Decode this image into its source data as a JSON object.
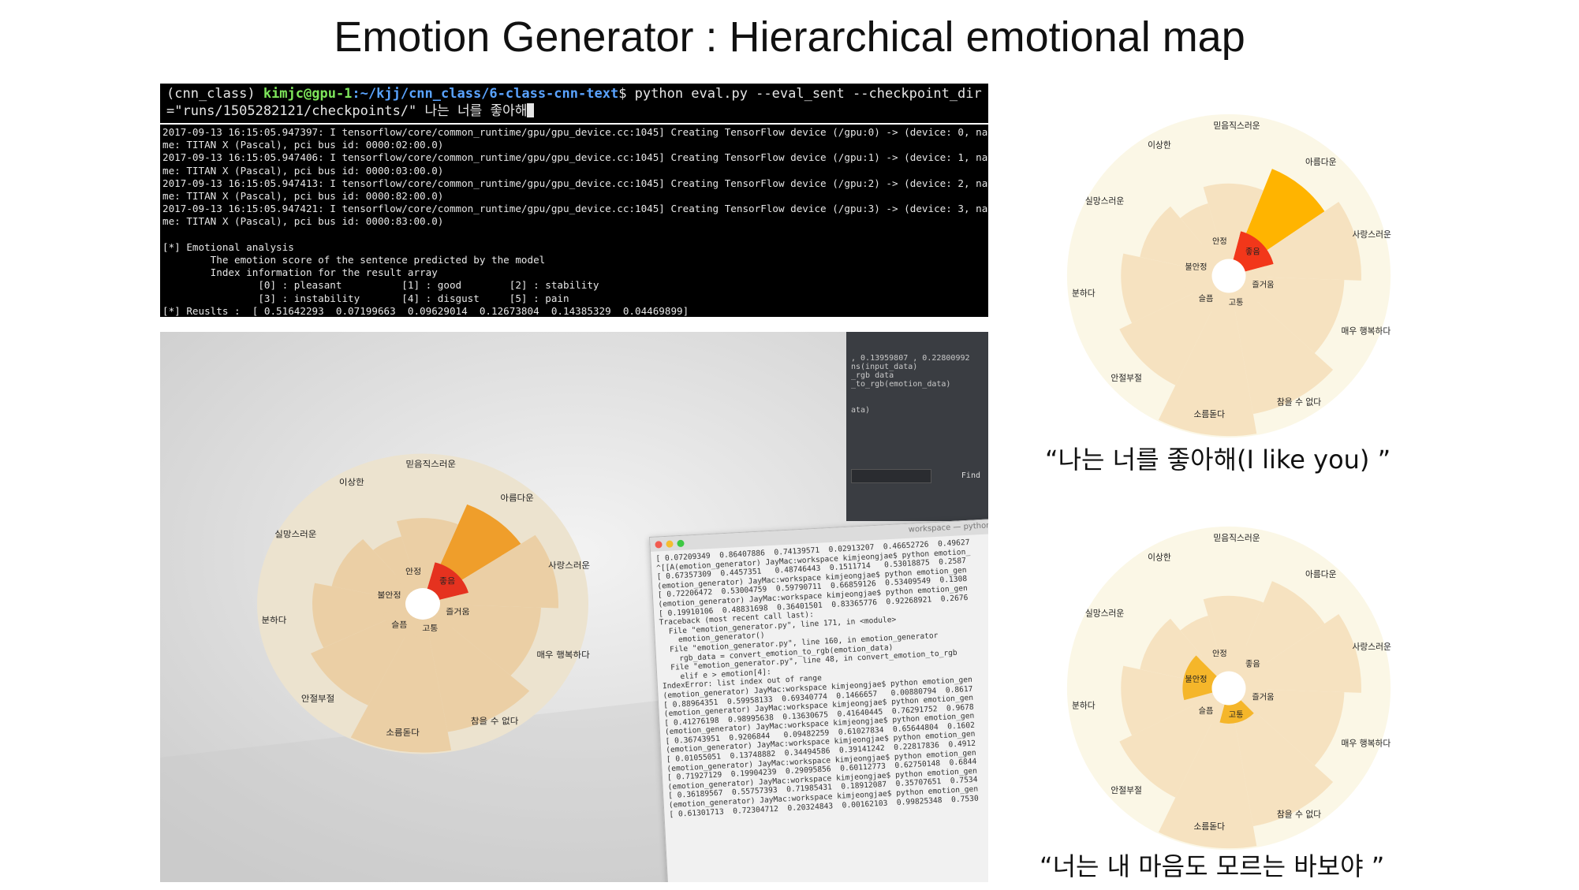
{
  "title": "Emotion Generator : Hierarchical emotional map",
  "terminal": {
    "env": "(cnn_class) ",
    "user": "kimjc@gpu-1",
    "path": ":~/kjj/cnn_class/6-class-cnn-text",
    "command": "$ python eval.py --eval_sent --checkpoint_dir",
    "command_cont": "=\"runs/1505282121/checkpoints/\" 나는 너를 좋아해",
    "log_lines": [
      "2017-09-13 16:15:05.947397: I tensorflow/core/common_runtime/gpu/gpu_device.cc:1045] Creating TensorFlow device (/gpu:0) -> (device: 0, na",
      "me: TITAN X (Pascal), pci bus id: 0000:02:00.0)",
      "2017-09-13 16:15:05.947406: I tensorflow/core/common_runtime/gpu/gpu_device.cc:1045] Creating TensorFlow device (/gpu:1) -> (device: 1, na",
      "me: TITAN X (Pascal), pci bus id: 0000:03:00.0)",
      "2017-09-13 16:15:05.947413: I tensorflow/core/common_runtime/gpu/gpu_device.cc:1045] Creating TensorFlow device (/gpu:2) -> (device: 2, na",
      "me: TITAN X (Pascal), pci bus id: 0000:82:00.0)",
      "2017-09-13 16:15:05.947421: I tensorflow/core/common_runtime/gpu/gpu_device.cc:1045] Creating TensorFlow device (/gpu:3) -> (device: 3, na",
      "me: TITAN X (Pascal), pci bus id: 0000:83:00.0)",
      "",
      "[*] Emotional analysis",
      "        The emotion score of the sentence predicted by the model",
      "        Index information for the result array",
      "                [0] : pleasant          [1] : good        [2] : stability",
      "                [3] : instability       [4] : disgust     [5] : pain",
      "[*] Reuslts :  [ 0.51642293  0.07199663  0.09629014  0.12673804  0.14385329  0.04469899]"
    ]
  },
  "photo": {
    "editor_lines": [
      ", 0.13959807 , 0.22800992",
      "ns(input_data)",
      "_rgb data",
      "_to_rgb(emotion_data)",
      "",
      "",
      "ata)"
    ],
    "editor_find": "Find",
    "term_title": "workspace — python e",
    "term_lines": [
      "[ 0.07209349  0.86407886  0.74139571  0.02913207  0.46652726  0.49627",
      "^[[A(emotion_generator) JayMac:workspace kimjeongjae$ python emotion_",
      "[ 0.67357309  0.4457351   0.48746443  0.1511714   0.53018875  0.2587",
      "(emotion_generator) JayMac:workspace kimjeongjae$ python emotion_gen",
      "[ 0.72206472  0.53004759  0.59790711  0.66859126  0.53409549  0.1308",
      "(emotion_generator) JayMac:workspace kimjeongjae$ python emotion_gen",
      "[ 0.19910106  0.48831698  0.36401501  0.83365776  0.92268921  0.2676",
      "Traceback (most recent call last):",
      "  File \"emotion_generator.py\", line 171, in <module>",
      "    emotion_generator()",
      "  File \"emotion_generator.py\", line 160, in emotion_generator",
      "    rgb_data = convert_emotion_to_rgb(emotion_data)",
      "  File \"emotion_generator.py\", line 48, in convert_emotion_to_rgb",
      "    elif e > emotion[4]:",
      "IndexError: list index out of range",
      "(emotion_generator) JayMac:workspace kimjeongjae$ python emotion_gen",
      "[ 0.88964351  0.59958133  0.69340774  0.1466657   0.00880794  0.8617",
      "(emotion_generator) JayMac:workspace kimjeongjae$ python emotion_gen",
      "[ 0.41276198  0.98995638  0.13630675  0.41640445  0.76291752  0.9678",
      "(emotion_generator) JayMac:workspace kimjeongjae$ python emotion_gen",
      "[ 0.36743951  0.9206844   0.09482259  0.61027834  0.65644804  0.1602",
      "(emotion_generator) JayMac:workspace kimjeongjae$ python emotion_gen",
      "[ 0.01055051  0.13748882  0.34494586  0.39141242  0.22817836  0.4912",
      "(emotion_generator) JayMac:workspace kimjeongjae$ python emotion_gen",
      "[ 0.71927129  0.19904239  0.29095856  0.60112773  0.62750148  0.6844",
      "(emotion_generator) JayMac:workspace kimjeongjae$ python emotion_gen",
      "[ 0.36189567  0.55757393  0.71985431  0.18912087  0.35707651  0.7534",
      "(emotion_generator) JayMac:workspace kimjeongjae$ python emotion_gen",
      "[ 0.61301713  0.72304712  0.20324843  0.00162103  0.99825348  0.7530"
    ]
  },
  "chart_data": [
    {
      "type": "sunburst",
      "caption": "“나는 너를 좋아해(I like you) ”",
      "colors": {
        "background": "#fbf7e6",
        "base": "#f6e2c0",
        "medium": "#f5b62a",
        "high": "#ffb400",
        "top": "#f2371a"
      },
      "inner": [
        {
          "label": "좋음",
          "level": "top"
        },
        {
          "label": "즐거움",
          "level": "base"
        },
        {
          "label": "고통",
          "level": "base"
        },
        {
          "label": "슬픔",
          "level": "base"
        },
        {
          "label": "불안정",
          "level": "base"
        },
        {
          "label": "안정",
          "level": "base"
        }
      ],
      "outer": [
        {
          "label": "아름다운",
          "level": "high"
        },
        {
          "label": "사랑스러운",
          "level": "base"
        },
        {
          "label": "매우 행복하다",
          "level": "base"
        },
        {
          "label": "참을 수 없다",
          "level": "base"
        },
        {
          "label": "소름돋다",
          "level": "base"
        },
        {
          "label": "안절부절",
          "level": "base"
        },
        {
          "label": "분하다",
          "level": "base"
        },
        {
          "label": "실망스러운",
          "level": "base"
        },
        {
          "label": "이상한",
          "level": "base"
        },
        {
          "label": "믿음직스러운",
          "level": "base"
        }
      ]
    },
    {
      "type": "sunburst",
      "caption": "“너는 내 마음도 모르는 바보야 ”",
      "colors": {
        "background": "#fbf7e6",
        "base": "#f6e2c0",
        "medium": "#f5b62a",
        "high": "#ffb400",
        "top": "#f2371a"
      },
      "inner": [
        {
          "label": "좋음",
          "level": "base"
        },
        {
          "label": "즐거움",
          "level": "base"
        },
        {
          "label": "고통",
          "level": "medium"
        },
        {
          "label": "슬픔",
          "level": "base"
        },
        {
          "label": "불안정",
          "level": "medium"
        },
        {
          "label": "안정",
          "level": "base"
        }
      ],
      "outer": [
        {
          "label": "아름다운",
          "level": "base"
        },
        {
          "label": "사랑스러운",
          "level": "base"
        },
        {
          "label": "매우 행복하다",
          "level": "base"
        },
        {
          "label": "참을 수 없다",
          "level": "base"
        },
        {
          "label": "소름돋다",
          "level": "base"
        },
        {
          "label": "안절부절",
          "level": "base"
        },
        {
          "label": "분하다",
          "level": "base"
        },
        {
          "label": "실망스러운",
          "level": "base"
        },
        {
          "label": "이상한",
          "level": "base"
        },
        {
          "label": "믿음직스러운",
          "level": "base"
        }
      ]
    },
    {
      "type": "sunburst",
      "caption": "",
      "colors": {
        "background": "#ece3cf",
        "base": "#ebcfa5",
        "medium": "#eaa244",
        "high": "#ef9e2b",
        "top": "#e5321f"
      },
      "inner": [
        {
          "label": "좋음",
          "level": "top"
        },
        {
          "label": "즐거움",
          "level": "base"
        },
        {
          "label": "고통",
          "level": "base"
        },
        {
          "label": "슬픔",
          "level": "base"
        },
        {
          "label": "불안정",
          "level": "base"
        },
        {
          "label": "안정",
          "level": "base"
        }
      ],
      "outer": [
        {
          "label": "아름다운",
          "level": "high"
        },
        {
          "label": "사랑스러운",
          "level": "base"
        },
        {
          "label": "매우 행복하다",
          "level": "base"
        },
        {
          "label": "참을 수 없다",
          "level": "base"
        },
        {
          "label": "소름돋다",
          "level": "base"
        },
        {
          "label": "안절부절",
          "level": "base"
        },
        {
          "label": "분하다",
          "level": "base"
        },
        {
          "label": "실망스러운",
          "level": "base"
        },
        {
          "label": "이상한",
          "level": "base"
        },
        {
          "label": "믿음직스러운",
          "level": "base"
        }
      ]
    }
  ]
}
